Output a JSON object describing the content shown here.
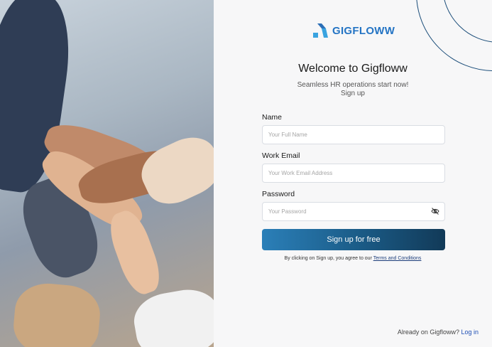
{
  "hero": {},
  "brand": {
    "logo_text": "GIGFLOWW",
    "accent_color": "#2474c4"
  },
  "heading": {
    "title": "Welcome to Gigfloww",
    "subtitle_line1": "Seamless HR operations start now!",
    "subtitle_line2": "Sign up"
  },
  "form": {
    "name_label": "Name",
    "name_placeholder": "Your Full Name",
    "email_label": "Work Email",
    "email_placeholder": "Your Work Email Address",
    "password_label": "Password",
    "password_placeholder": "Your Password",
    "password_toggle_icon": "eye-off-icon",
    "submit_label": "Sign up for free"
  },
  "terms": {
    "prefix": "By clicking on Sign up, you agree to our",
    "link": "Terms and Conditions"
  },
  "footer": {
    "prompt": "Already on Gigfloww?",
    "login_link": "Log in"
  }
}
